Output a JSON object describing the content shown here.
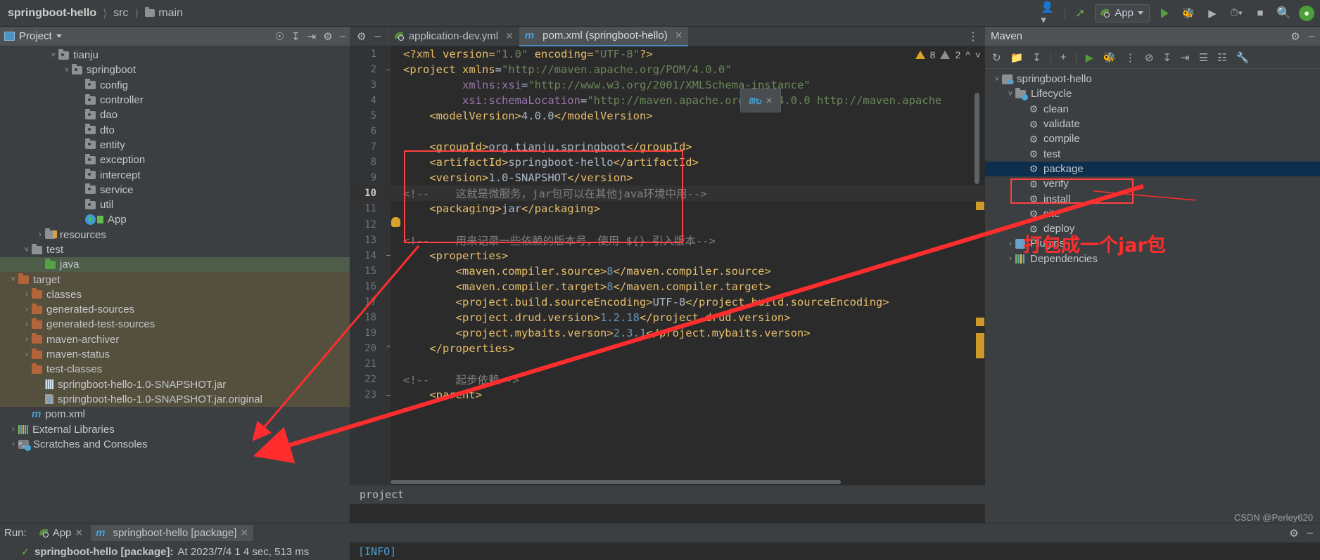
{
  "window": {
    "breadcrumb": [
      {
        "label": "springboot-hello",
        "icon": "none"
      },
      {
        "label": "src",
        "icon": "none"
      },
      {
        "label": "main",
        "icon": "folder-icon"
      }
    ],
    "run_config": "App",
    "icons": {
      "profile": "profile-icon",
      "build": "hammer-icon",
      "run": "run-icon",
      "debug": "debug-icon",
      "run_coverage": "run-coverage-icon",
      "profiler": "profiler-icon",
      "stop": "stop-icon",
      "search": "search-icon",
      "account": "account-avatar"
    }
  },
  "project_panel": {
    "title": "Project",
    "tree": [
      {
        "label": "tianju",
        "depth": 4,
        "icon": "package-folder",
        "arrow": "expanded"
      },
      {
        "label": "springboot",
        "depth": 5,
        "icon": "package-folder",
        "arrow": "expanded"
      },
      {
        "label": "config",
        "depth": 6,
        "icon": "package-folder",
        "arrow": "none"
      },
      {
        "label": "controller",
        "depth": 6,
        "icon": "package-folder",
        "arrow": "none"
      },
      {
        "label": "dao",
        "depth": 6,
        "icon": "package-folder",
        "arrow": "none"
      },
      {
        "label": "dto",
        "depth": 6,
        "icon": "package-folder",
        "arrow": "none"
      },
      {
        "label": "entity",
        "depth": 6,
        "icon": "package-folder",
        "arrow": "none"
      },
      {
        "label": "exception",
        "depth": 6,
        "icon": "package-folder",
        "arrow": "none"
      },
      {
        "label": "intercept",
        "depth": 6,
        "icon": "package-folder",
        "arrow": "none"
      },
      {
        "label": "service",
        "depth": 6,
        "icon": "package-folder",
        "arrow": "none"
      },
      {
        "label": "util",
        "depth": 6,
        "icon": "package-folder",
        "arrow": "none"
      },
      {
        "label": "App",
        "depth": 6,
        "icon": "java-class-run",
        "arrow": "none"
      },
      {
        "label": "resources",
        "depth": 3,
        "icon": "resources-folder",
        "arrow": "collapsed"
      },
      {
        "label": "test",
        "depth": 2,
        "icon": "folder",
        "arrow": "expanded"
      },
      {
        "label": "java",
        "depth": 3,
        "icon": "source-folder-green",
        "arrow": "none",
        "state": "selected"
      },
      {
        "label": "target",
        "depth": 1,
        "icon": "excluded-folder",
        "arrow": "expanded",
        "state": "target"
      },
      {
        "label": "classes",
        "depth": 2,
        "icon": "excluded-folder",
        "arrow": "collapsed",
        "state": "target"
      },
      {
        "label": "generated-sources",
        "depth": 2,
        "icon": "excluded-folder",
        "arrow": "collapsed",
        "state": "target"
      },
      {
        "label": "generated-test-sources",
        "depth": 2,
        "icon": "excluded-folder",
        "arrow": "collapsed",
        "state": "target"
      },
      {
        "label": "maven-archiver",
        "depth": 2,
        "icon": "excluded-folder",
        "arrow": "collapsed",
        "state": "target"
      },
      {
        "label": "maven-status",
        "depth": 2,
        "icon": "excluded-folder",
        "arrow": "collapsed",
        "state": "target"
      },
      {
        "label": "test-classes",
        "depth": 2,
        "icon": "excluded-folder",
        "arrow": "none",
        "state": "target"
      },
      {
        "label": "springboot-hello-1.0-SNAPSHOT.jar",
        "depth": 3,
        "icon": "jar-file",
        "arrow": "none",
        "state": "target"
      },
      {
        "label": "springboot-hello-1.0-SNAPSHOT.jar.original",
        "depth": 3,
        "icon": "unknown-file",
        "arrow": "none",
        "state": "target"
      },
      {
        "label": "pom.xml",
        "depth": 2,
        "icon": "maven-file",
        "arrow": "none"
      },
      {
        "label": "External Libraries",
        "depth": 1,
        "icon": "library-icon",
        "arrow": "collapsed"
      },
      {
        "label": "Scratches and Consoles",
        "depth": 1,
        "icon": "scratches-icon",
        "arrow": "collapsed"
      }
    ]
  },
  "editor": {
    "tabs": [
      {
        "label": "application-dev.yml",
        "icon": "spring-icon",
        "active": false
      },
      {
        "label": "pom.xml (springboot-hello)",
        "icon": "maven-icon",
        "active": true
      }
    ],
    "warnings": {
      "error_count": "8",
      "warning_count": "2"
    },
    "status": "project",
    "lines": [
      {
        "n": "1",
        "fold": "",
        "html": "<span class='t-pi'>&lt;?xml </span><span class='t-tag'>version</span><span class='t-pi'>=</span><span class='t-str'>\"1.0\"</span> <span class='t-tag'>encoding</span><span class='t-pi'>=</span><span class='t-str'>\"UTF-8\"</span><span class='t-pi'>?&gt;</span>"
      },
      {
        "n": "2",
        "fold": "−",
        "html": "<span class='t-tag'>&lt;project </span><span class='t-tag'>xmlns</span><span class='t-val'>=</span><span class='t-str'>\"http://maven.apache.org/POM/4.0.0\"</span>"
      },
      {
        "n": "3",
        "fold": "",
        "html": "         <span class='t-attr'>xmlns:xsi</span><span class='t-val'>=</span><span class='t-str'>\"http://www.w3.org/2001/XMLSchema-instance\"</span>"
      },
      {
        "n": "4",
        "fold": "",
        "html": "         <span class='t-attr'>xsi:schemaLocation</span><span class='t-val'>=</span><span class='t-str'>\"http://maven.apache.org/POM/4.0.0 http://maven.apache</span>"
      },
      {
        "n": "5",
        "fold": "",
        "html": "    <span class='t-tag'>&lt;modelVersion&gt;</span><span class='t-val'>4.0.0</span><span class='t-tag'>&lt;/modelVersion&gt;</span>"
      },
      {
        "n": "6",
        "fold": "",
        "html": ""
      },
      {
        "n": "7",
        "fold": "",
        "html": "    <span class='t-tag'>&lt;groupId&gt;</span><span class='t-val'>org.tianju.springboot</span><span class='t-tag'>&lt;/groupId&gt;</span>"
      },
      {
        "n": "8",
        "fold": "",
        "html": "    <span class='t-tag'>&lt;artifactId&gt;</span><span class='t-val'>springboot-hello</span><span class='t-tag'>&lt;/artifactId&gt;</span>"
      },
      {
        "n": "9",
        "fold": "",
        "html": "    <span class='t-tag'>&lt;version&gt;</span><span class='t-val'>1.0-SNAPSHOT</span><span class='t-tag'>&lt;/version&gt;</span>"
      },
      {
        "n": "10",
        "fold": "",
        "cur": true,
        "html": "<span class='t-cmt'>&lt;!--    这就是微服务，jar包可以在其他java环境中用--&gt;</span>"
      },
      {
        "n": "11",
        "fold": "",
        "html": "    <span class='t-tag'>&lt;packaging&gt;</span><span class='t-val'>jar</span><span class='t-tag'>&lt;/packaging&gt;</span>"
      },
      {
        "n": "12",
        "fold": "",
        "html": ""
      },
      {
        "n": "13",
        "fold": "",
        "html": "<span class='t-cmt'>&lt;!--    用来记录一些依赖的版本号，使用 ${} 引入版本--&gt;</span>"
      },
      {
        "n": "14",
        "fold": "−",
        "html": "    <span class='t-tag'>&lt;properties&gt;</span>"
      },
      {
        "n": "15",
        "fold": "",
        "html": "        <span class='t-tag'>&lt;maven.compiler.source&gt;</span><span class='t-num'>8</span><span class='t-tag'>&lt;/maven.compiler.source&gt;</span>"
      },
      {
        "n": "16",
        "fold": "",
        "html": "        <span class='t-tag'>&lt;maven.compiler.target&gt;</span><span class='t-num'>8</span><span class='t-tag'>&lt;/maven.compiler.target&gt;</span>"
      },
      {
        "n": "17",
        "fold": "",
        "html": "        <span class='t-tag'>&lt;project.build.sourceEncoding&gt;</span><span class='t-val'>UTF-8</span><span class='t-tag'>&lt;/project.build.sourceEncoding&gt;</span>"
      },
      {
        "n": "18",
        "fold": "",
        "html": "        <span class='t-tag'>&lt;project.drud.version&gt;</span><span class='t-num'>1.2.18</span><span class='t-tag'>&lt;/project.drud.version&gt;</span>"
      },
      {
        "n": "19",
        "fold": "",
        "html": "        <span class='t-tag'>&lt;project.mybaits.verson&gt;</span><span class='t-num'>2.3.1</span><span class='t-tag'>&lt;/project.mybaits.verson&gt;</span>"
      },
      {
        "n": "20",
        "fold": "⌃",
        "html": "    <span class='t-tag'>&lt;/properties&gt;</span>"
      },
      {
        "n": "21",
        "fold": "",
        "html": ""
      },
      {
        "n": "22",
        "fold": "",
        "html": "<span class='t-cmt'>&lt;!--    起步依赖--&gt;</span>"
      },
      {
        "n": "23",
        "fold": "−",
        "html": "    <span class='t-tag'>&lt;parent&gt;</span>"
      }
    ]
  },
  "maven_panel": {
    "title": "Maven",
    "toolbar_icons": [
      "reload-icon",
      "add-module-icon",
      "download-sources-icon",
      "add-icon",
      "run-icon",
      "debug-icon",
      "skip-tests-icon",
      "toggle-offline-icon",
      "expand-all-icon",
      "collapse-all-icon",
      "show-diagram-icon",
      "show-dependencies-icon",
      "settings-icon"
    ],
    "tree": [
      {
        "label": "springboot-hello",
        "depth": 0,
        "icon": "maven-project-icon",
        "arrow": "expanded"
      },
      {
        "label": "Lifecycle",
        "depth": 1,
        "icon": "lifecycle-folder-icon",
        "arrow": "expanded"
      },
      {
        "label": "clean",
        "depth": 2,
        "icon": "goal-icon",
        "arrow": "none"
      },
      {
        "label": "validate",
        "depth": 2,
        "icon": "goal-icon",
        "arrow": "none"
      },
      {
        "label": "compile",
        "depth": 2,
        "icon": "goal-icon",
        "arrow": "none"
      },
      {
        "label": "test",
        "depth": 2,
        "icon": "goal-icon",
        "arrow": "none"
      },
      {
        "label": "package",
        "depth": 2,
        "icon": "goal-icon",
        "arrow": "none",
        "state": "selected"
      },
      {
        "label": "verify",
        "depth": 2,
        "icon": "goal-icon",
        "arrow": "none"
      },
      {
        "label": "install",
        "depth": 2,
        "icon": "goal-icon",
        "arrow": "none"
      },
      {
        "label": "site",
        "depth": 2,
        "icon": "goal-icon",
        "arrow": "none"
      },
      {
        "label": "deploy",
        "depth": 2,
        "icon": "goal-icon",
        "arrow": "none"
      },
      {
        "label": "Plugins",
        "depth": 1,
        "icon": "plugins-icon",
        "arrow": "collapsed"
      },
      {
        "label": "Dependencies",
        "depth": 1,
        "icon": "dependencies-icon",
        "arrow": "collapsed"
      }
    ],
    "annotation": "打包成一个jar包"
  },
  "run_panel": {
    "run_label": "Run:",
    "tabs": [
      {
        "label": "App",
        "icon": "spring-icon",
        "active": false
      },
      {
        "label": "springboot-hello [package]",
        "icon": "maven-icon",
        "active": true
      }
    ],
    "status_text": "springboot-hello [package]:",
    "status_detail": "At 2023/7/4 1 4 sec, 513 ms",
    "console_line": "[INFO]",
    "watermark": "CSDN @Perley620"
  },
  "colors": {
    "accent_red": "#ff2d2d",
    "selection_blue": "#0d2e4d",
    "selection_green": "#4e5c4a",
    "target_bg": "#55503e",
    "editor_bg": "#2b2b2b",
    "panel_bg": "#3c3f41"
  }
}
